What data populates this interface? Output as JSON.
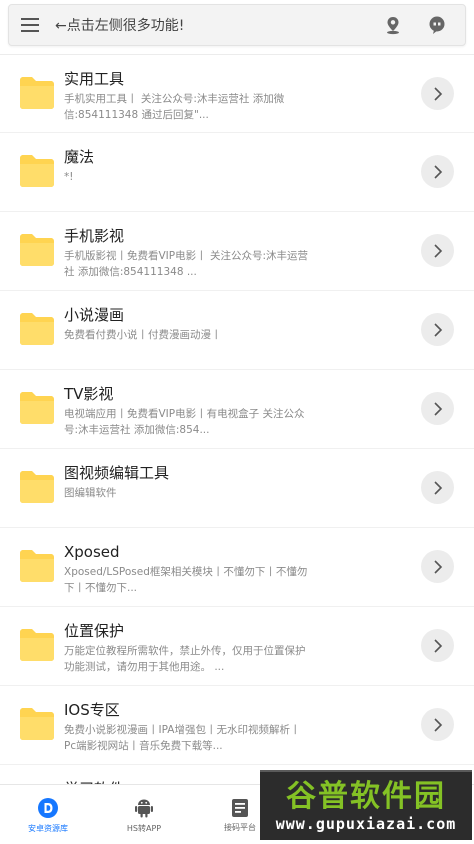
{
  "header": {
    "hint": "←点击左侧很多功能!",
    "menu_icon": "hamburger-menu-icon",
    "location_icon": "location-icon",
    "chat_icon": "message-icon"
  },
  "colors": {
    "folder": "#FFD451",
    "accent": "#1677FF",
    "watermark_green": "#84C225"
  },
  "items": [
    {
      "title": "实用工具",
      "sub": "手机实用工具丨 关注公众号:沐丰运营社 添加微信:854111348 通过后回复\"..."
    },
    {
      "title": "魔法",
      "sub": "*!"
    },
    {
      "title": "手机影视",
      "sub": "手机版影视丨免费看VIP电影丨 关注公众号:沐丰运营社 添加微信:854111348 ..."
    },
    {
      "title": "小说漫画",
      "sub": "免费看付费小说丨付费漫画动漫丨"
    },
    {
      "title": "TV影视",
      "sub": "电视端应用丨免费看VIP电影丨有电视盒子 关注公众号:沐丰运营社 添加微信:854..."
    },
    {
      "title": "图视频编辑工具",
      "sub": "图编辑软件"
    },
    {
      "title": "Xposed",
      "sub": "Xposed/LSPosed框架相关模块丨不懂勿下丨不懂勿下丨不懂勿下..."
    },
    {
      "title": "位置保护",
      "sub": "万能定位教程所需软件，禁止外传，仅用于位置保护功能测试，请勿用于其他用途。 ..."
    },
    {
      "title": "IOS专区",
      "sub": "免费小说影视漫画丨IPA增强包丨无水印视频解析丨Pc端影视网站丨音乐免费下载等..."
    },
    {
      "title": "学习软件",
      "sub": ""
    }
  ],
  "tabs": [
    {
      "label": "安卓资源库",
      "icon": "d-logo-icon"
    },
    {
      "label": "HS转APP",
      "icon": "android-icon"
    },
    {
      "label": "接码平台",
      "icon": "document-icon"
    }
  ],
  "watermark": {
    "title": "谷普软件园",
    "url": "www.gupuxiazai.com"
  }
}
